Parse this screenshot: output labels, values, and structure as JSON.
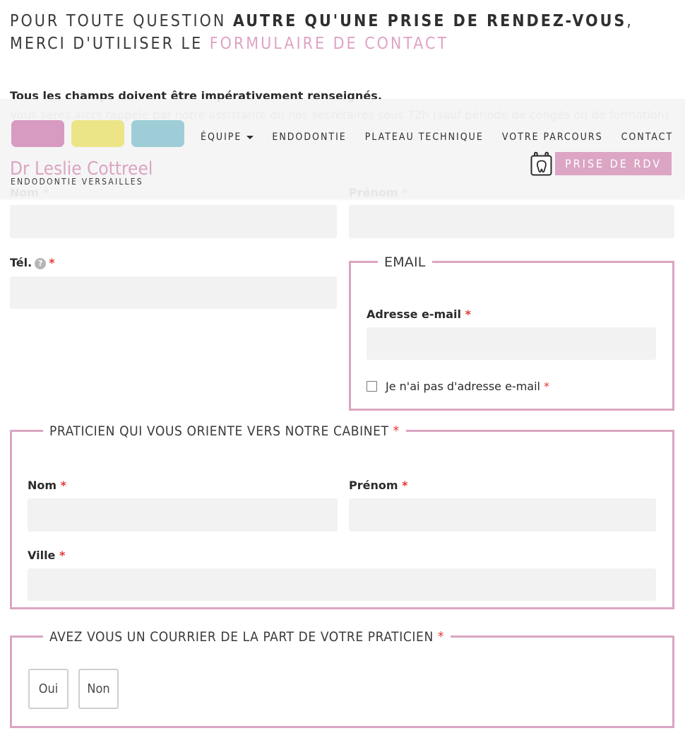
{
  "page_heading": {
    "line1_prefix": "POUR TOUTE QUESTION ",
    "line1_strong": "AUTRE QU'UNE PRISE DE RENDEZ-VOUS",
    "line1_suffix": ",",
    "line2_prefix": "MERCI D'UTILISER LE ",
    "line2_link": "FORMULAIRE DE CONTACT"
  },
  "intro": {
    "bold": "Tous les champs doivent être impérativement renseignés.",
    "sub": "Vous serez alors rappelé par notre assistante ou nos secrétaires sous 72h (sauf période de congés ou de formation)"
  },
  "header": {
    "brand_name": "Dr Leslie Cottreel",
    "brand_subtitle": "ENDODONTIE VERSAILLES",
    "swatch_colors": [
      "#d79ac0",
      "#ece588",
      "#9ecdd7"
    ],
    "nav": [
      {
        "label": "ÉQUIPE",
        "has_caret": true
      },
      {
        "label": "ENDODONTIE",
        "has_caret": false
      },
      {
        "label": "PLATEAU TECHNIQUE",
        "has_caret": false
      },
      {
        "label": "VOTRE PARCOURS",
        "has_caret": false
      },
      {
        "label": "CONTACT",
        "has_caret": false
      }
    ],
    "rdv_button": "PRISE DE RDV",
    "accent_color": "#dba5c3"
  },
  "form": {
    "required_mark": "*",
    "nom_label": "Nom",
    "prenom_label": "Prénom",
    "tel_label": "Tél.",
    "tel_help_glyph": "?",
    "email_fieldset": {
      "legend": "EMAIL",
      "address_label": "Adresse e-mail",
      "no_email_checkbox": "Je n'ai pas d'adresse e-mail"
    },
    "praticien_fieldset": {
      "legend": "PRATICIEN QUI VOUS ORIENTE VERS NOTRE CABINET",
      "nom_label": "Nom",
      "prenom_label": "Prénom",
      "ville_label": "Ville"
    },
    "courrier_fieldset": {
      "legend": "AVEZ VOUS UN COURRIER DE LA PART DE VOTRE PRATICIEN",
      "options": [
        "Oui",
        "Non"
      ]
    }
  }
}
